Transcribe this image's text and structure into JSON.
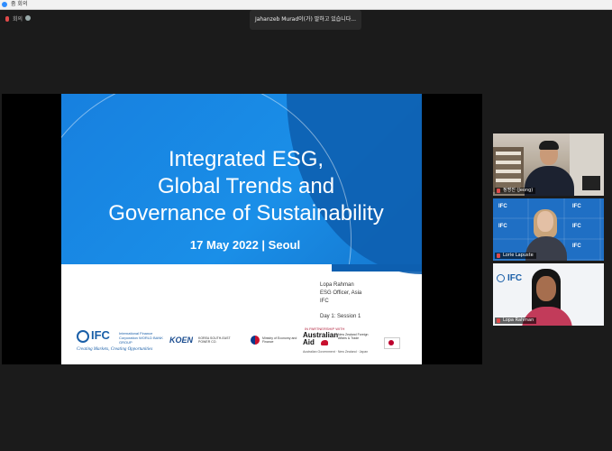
{
  "window": {
    "title": "줌 회의"
  },
  "toolbar": {
    "status_text": "회의"
  },
  "active_speaker": {
    "label": "Jahanzeb Murad이(가) 말하고 있습니다..."
  },
  "slide": {
    "title_lines": [
      "Integrated ESG,",
      "Global Trends and",
      "Governance of Sustainability"
    ],
    "date": "17 May 2022 | Seoul",
    "presenter_name": "Lopa Rahman",
    "presenter_role": "ESG Officer, Asia",
    "presenter_org": "IFC",
    "session": "Day 1: Session 1",
    "partnership_label": "IN PARTNERSHIP WITH",
    "ifc_logo": "IFC",
    "ifc_sub": "International Finance Corporation WORLD BANK GROUP",
    "ifc_tagline": "Creating Markets, Creating Opportunities",
    "koen_logo": "KOEN",
    "koen_sub": "KOREA SOUTH-EAST POWER CO.",
    "moef_text": "Ministry of Economy and Finance",
    "aus_aid_line1": "Australian",
    "aus_aid_line2": "Aid",
    "nz_text": "New Zealand Foreign Affairs & Trade",
    "partner_line": "Australian Government · New Zealand · Japan"
  },
  "participants": [
    {
      "name": "정명진 (Jeong)"
    },
    {
      "name": "Lorie Lapuste"
    },
    {
      "name": "Lopa Rahman"
    }
  ],
  "tile2": {
    "logo_text": "IFC"
  },
  "tile3": {
    "logo_text": "IFC"
  }
}
